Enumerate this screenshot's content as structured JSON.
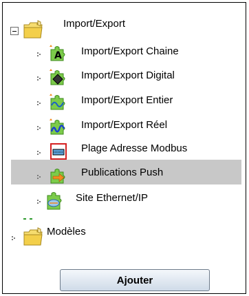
{
  "tree": {
    "root": {
      "label": "Import/Export",
      "icon": "folder-icon"
    },
    "children": [
      {
        "label": "Import/Export Chaine",
        "icon": "letter-a-puzzle-icon"
      },
      {
        "label": "Import/Export Digital",
        "icon": "diamond-puzzle-icon"
      },
      {
        "label": "Import/Export Entier",
        "icon": "wave-puzzle-icon"
      },
      {
        "label": "Import/Export Réel",
        "icon": "blue-wave-puzzle-icon"
      },
      {
        "label": "Plage Adresse Modbus",
        "icon": "modbus-range-icon"
      },
      {
        "label": "Publications Push",
        "icon": "push-arrow-puzzle-icon"
      },
      {
        "label": "Site Ethernet/IP",
        "icon": "ethernet-ip-icon"
      }
    ],
    "second_root": {
      "label": "Modèles",
      "icon": "folder-icon"
    }
  },
  "actions": {
    "add_label": "Ajouter"
  },
  "colors": {
    "selection": "#c8c8c8",
    "folder": "#f3d35a",
    "puzzle_green": "#7ccb4a",
    "accent_orange": "#f28b1e"
  }
}
